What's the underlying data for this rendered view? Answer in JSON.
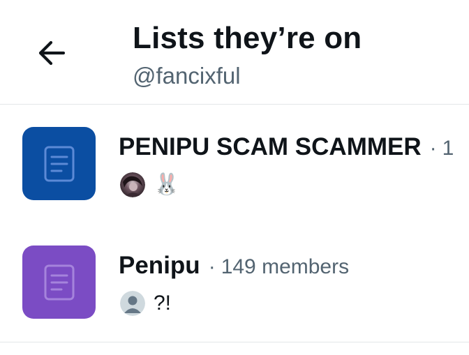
{
  "header": {
    "back_icon": "arrow-left-icon",
    "title": "Lists they’re on",
    "handle": "@fancixful"
  },
  "lists": [
    {
      "name": "PENIPU SCAM SCAMMER",
      "separator": "·",
      "members_text": "1",
      "icon": "list-document-icon",
      "icon_color": "#0b4ea2",
      "owner_name": "🐰",
      "owner_avatar": "photo-avatar"
    },
    {
      "name": "Penipu",
      "separator": "·",
      "members_text": "149 members",
      "icon": "list-document-icon",
      "icon_color": "#7b4cc4",
      "owner_name": "?!",
      "owner_avatar": "default-avatar"
    }
  ],
  "colors": {
    "text_primary": "#0f1419",
    "text_secondary": "#536471",
    "divider": "#e3e6e8"
  }
}
